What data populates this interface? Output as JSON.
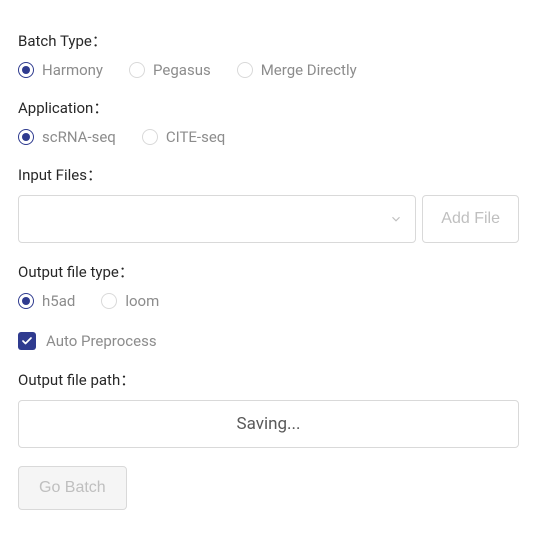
{
  "batch_type": {
    "label": "Batch Type：",
    "options": [
      {
        "label": "Harmony",
        "checked": true
      },
      {
        "label": "Pegasus",
        "checked": false
      },
      {
        "label": "Merge Directly",
        "checked": false
      }
    ]
  },
  "application": {
    "label": "Application：",
    "options": [
      {
        "label": "scRNA-seq",
        "checked": true
      },
      {
        "label": "CITE-seq",
        "checked": false
      }
    ]
  },
  "input_files": {
    "label": "Input Files：",
    "value": "",
    "add_button": "Add File"
  },
  "output_file_type": {
    "label": "Output file type：",
    "options": [
      {
        "label": "h5ad",
        "checked": true
      },
      {
        "label": "loom",
        "checked": false
      }
    ]
  },
  "auto_preprocess": {
    "label": "Auto Preprocess",
    "checked": true
  },
  "output_file_path": {
    "label": "Output file path：",
    "status": "Saving..."
  },
  "go_button": "Go Batch"
}
